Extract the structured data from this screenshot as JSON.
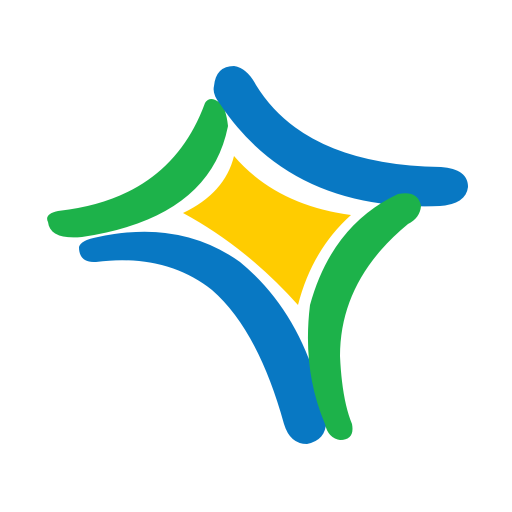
{
  "logo": {
    "name": "four-point-star-logo",
    "colors": {
      "background": "#ffffff",
      "blue": "#0878c3",
      "green": "#1db24a",
      "yellow": "#ffcc00"
    }
  }
}
